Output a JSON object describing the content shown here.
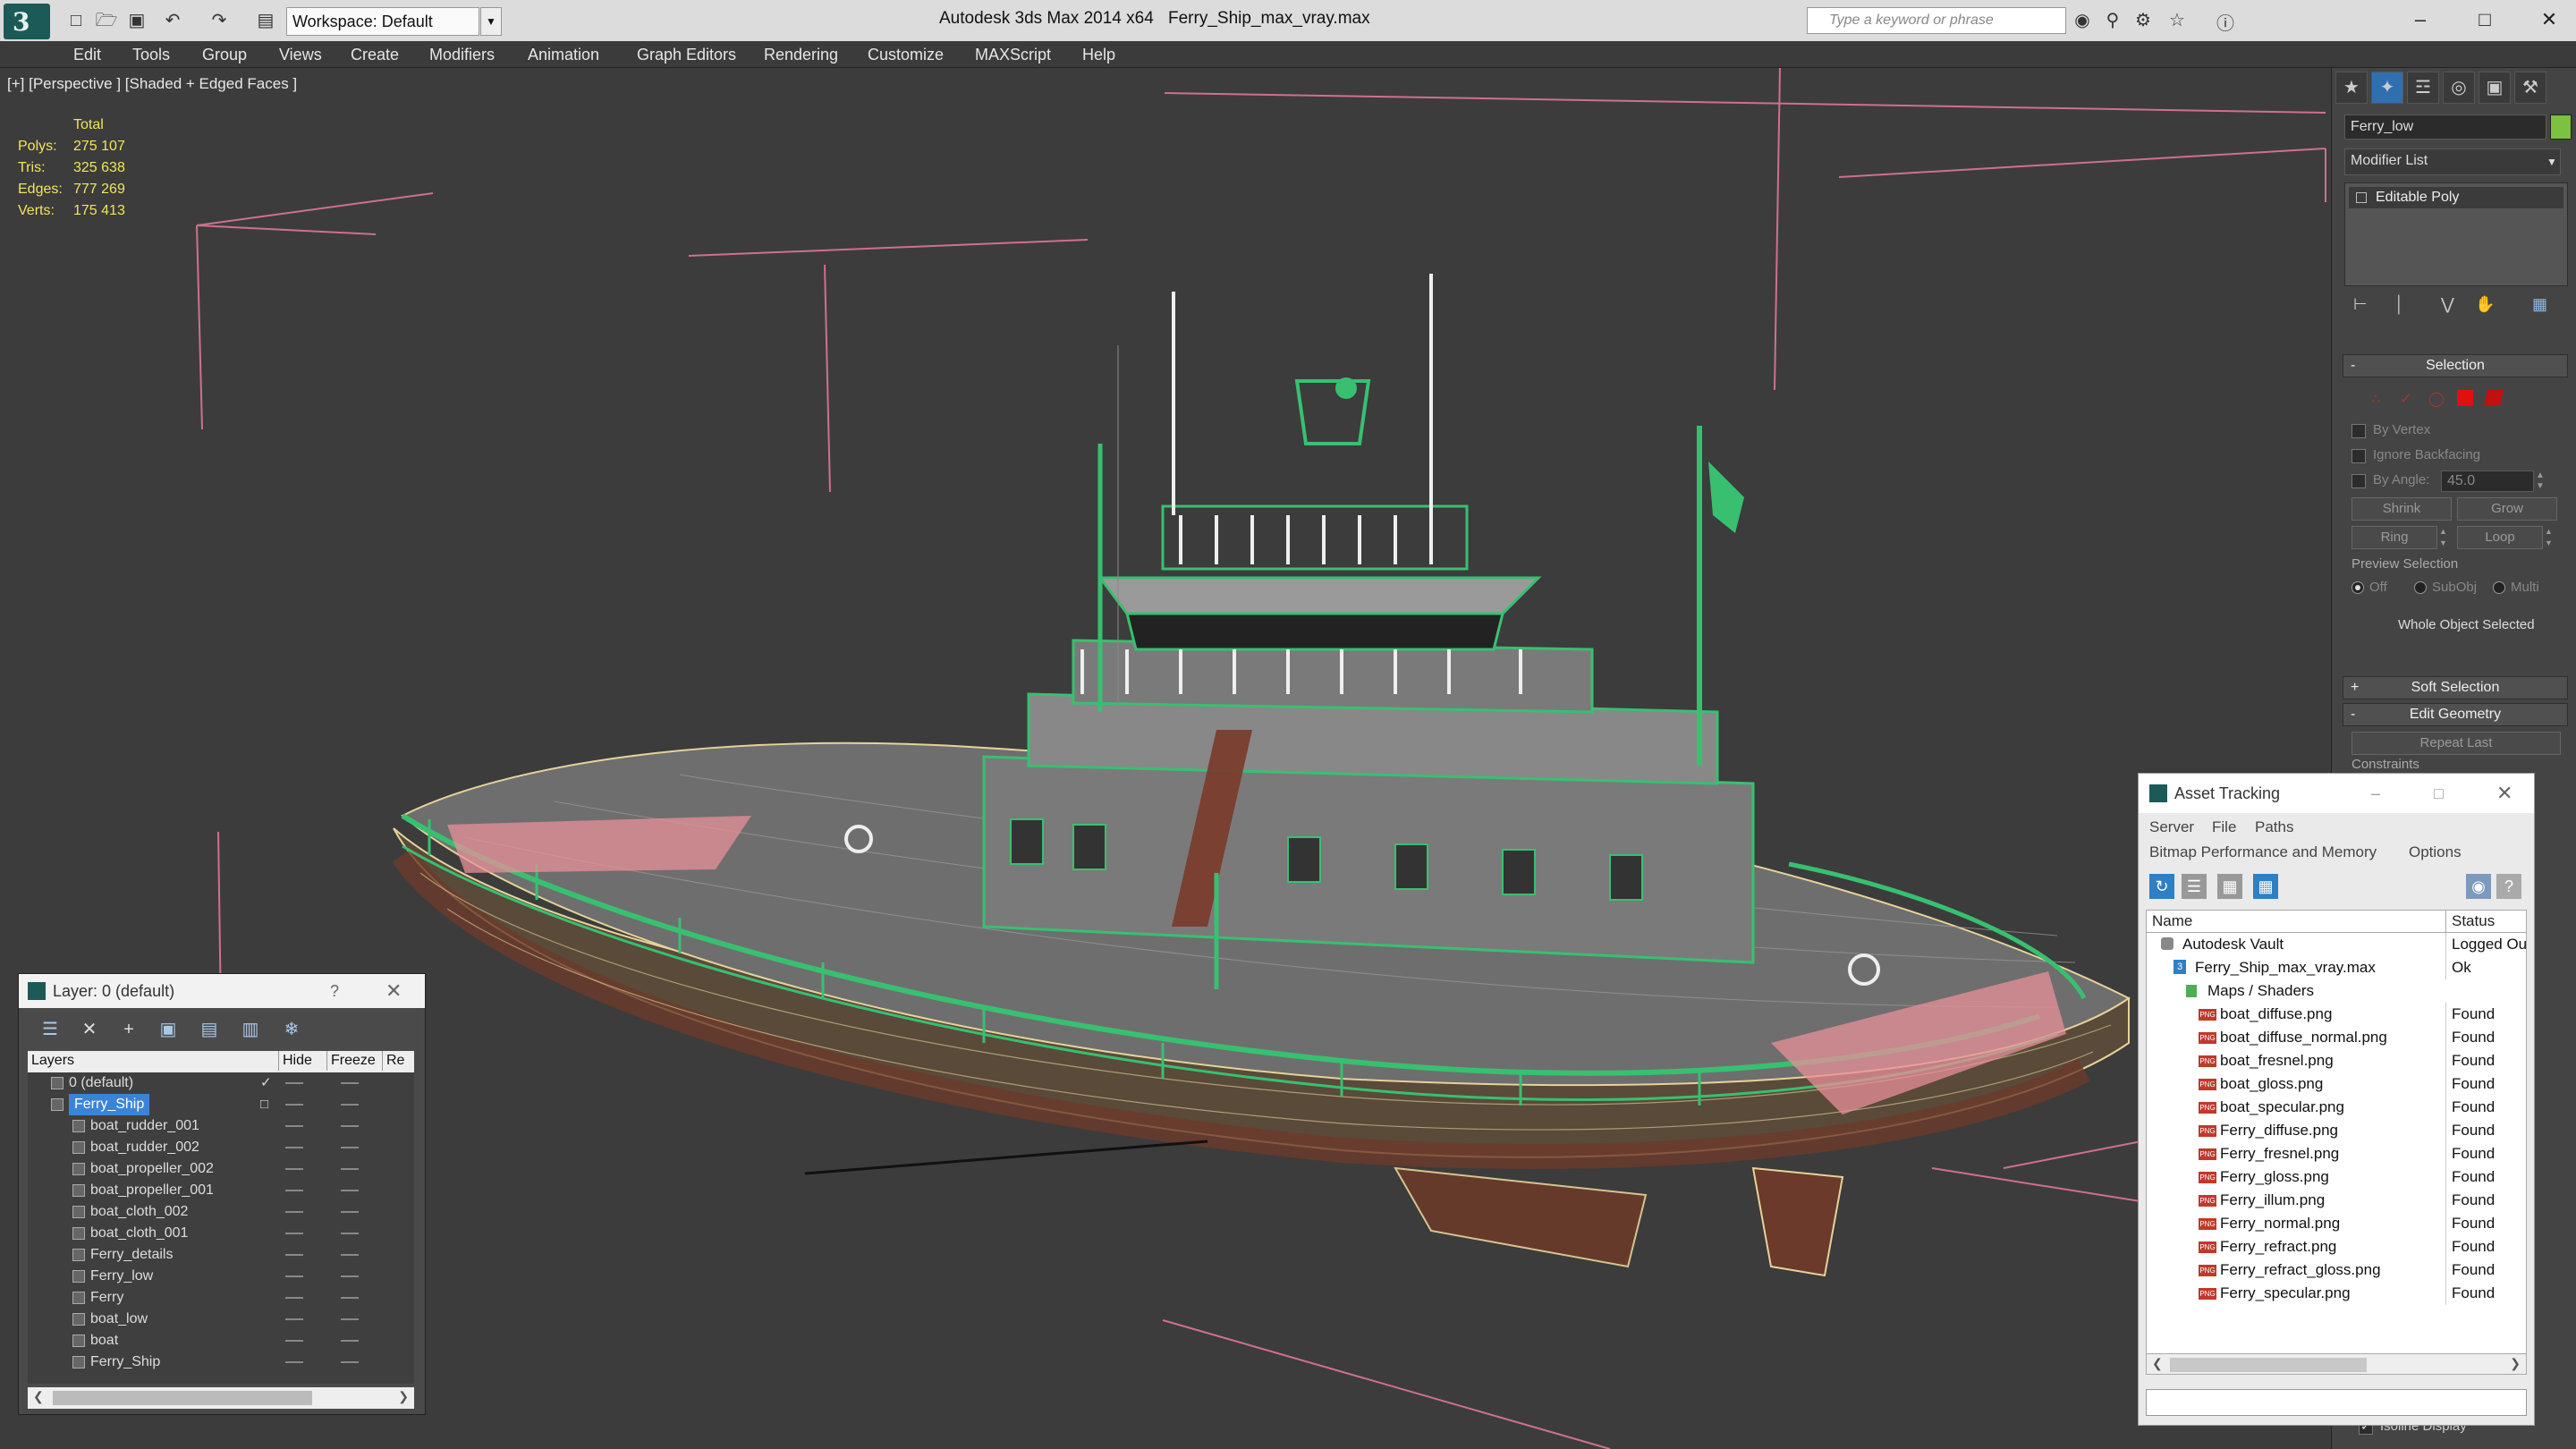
{
  "titlebar": {
    "logo_glyph": "3",
    "workspace": "Workspace: Default",
    "app_title": "Autodesk 3ds Max  2014 x64",
    "file_title": "Ferry_Ship_max_vray.max",
    "search_placeholder": "Type a keyword or phrase"
  },
  "menu": [
    "Edit",
    "Tools",
    "Group",
    "Views",
    "Create",
    "Modifiers",
    "Animation",
    "Graph Editors",
    "Rendering",
    "Customize",
    "MAXScript",
    "Help"
  ],
  "viewport": {
    "label": "[+] [Perspective ] [Shaded + Edged Faces ]",
    "stats_header": "Total",
    "stats": [
      {
        "key": "Polys:",
        "value": "275 107"
      },
      {
        "key": "Tris:",
        "value": "325 638"
      },
      {
        "key": "Edges:",
        "value": "777 269"
      },
      {
        "key": "Verts:",
        "value": "175 413"
      }
    ]
  },
  "command_panel": {
    "object_name": "Ferry_low",
    "object_color": "#7dc142",
    "modifier_list": "Modifier List",
    "stack_item": "Editable Poly",
    "selection_title": "Selection",
    "by_vertex": "By Vertex",
    "ignore_backfacing": "Ignore Backfacing",
    "by_angle": "By Angle:",
    "angle_value": "45.0",
    "shrink": "Shrink",
    "grow": "Grow",
    "ring": "Ring",
    "loop": "Loop",
    "preview_selection": "Preview Selection",
    "off": "Off",
    "subobj": "SubObj",
    "multi": "Multi",
    "whole_object": "Whole Object Selected",
    "soft_selection": "Soft Selection",
    "edit_geometry": "Edit Geometry",
    "repeat_last": "Repeat Last",
    "constraints": "Constraints",
    "isoline": "Isoline Display"
  },
  "layer_dialog": {
    "title": "Layer: 0 (default)",
    "help": "?",
    "col_layers": "Layers",
    "col_hide": "Hide",
    "col_freeze": "Freeze",
    "col_render": "Re",
    "rows": [
      {
        "name": "0 (default)",
        "indent": 0,
        "checked": true
      },
      {
        "name": "Ferry_Ship",
        "indent": 0,
        "selected": true
      },
      {
        "name": "boat_rudder_001",
        "indent": 1
      },
      {
        "name": "boat_rudder_002",
        "indent": 1
      },
      {
        "name": "boat_propeller_002",
        "indent": 1
      },
      {
        "name": "boat_propeller_001",
        "indent": 1
      },
      {
        "name": "boat_cloth_002",
        "indent": 1
      },
      {
        "name": "boat_cloth_001",
        "indent": 1
      },
      {
        "name": "Ferry_details",
        "indent": 1
      },
      {
        "name": "Ferry_low",
        "indent": 1
      },
      {
        "name": "Ferry",
        "indent": 1
      },
      {
        "name": "boat_low",
        "indent": 1
      },
      {
        "name": "boat",
        "indent": 1
      },
      {
        "name": "Ferry_Ship",
        "indent": 1
      }
    ]
  },
  "asset_tracking": {
    "title": "Asset Tracking",
    "menu_server": "Server",
    "menu_file": "File",
    "menu_paths": "Paths",
    "menu_bitmap": "Bitmap Performance and Memory",
    "menu_options": "Options",
    "col_name": "Name",
    "col_status": "Status",
    "rows": [
      {
        "name": "Autodesk Vault",
        "status": "Logged Ou",
        "level": 0
      },
      {
        "name": "Ferry_Ship_max_vray.max",
        "status": "Ok",
        "level": 1
      },
      {
        "name": "Maps / Shaders",
        "status": "",
        "level": 2
      },
      {
        "name": "boat_diffuse.png",
        "status": "Found",
        "level": 3
      },
      {
        "name": "boat_diffuse_normal.png",
        "status": "Found",
        "level": 3
      },
      {
        "name": "boat_fresnel.png",
        "status": "Found",
        "level": 3
      },
      {
        "name": "boat_gloss.png",
        "status": "Found",
        "level": 3
      },
      {
        "name": "boat_specular.png",
        "status": "Found",
        "level": 3
      },
      {
        "name": "Ferry_diffuse.png",
        "status": "Found",
        "level": 3
      },
      {
        "name": "Ferry_fresnel.png",
        "status": "Found",
        "level": 3
      },
      {
        "name": "Ferry_gloss.png",
        "status": "Found",
        "level": 3
      },
      {
        "name": "Ferry_illum.png",
        "status": "Found",
        "level": 3
      },
      {
        "name": "Ferry_normal.png",
        "status": "Found",
        "level": 3
      },
      {
        "name": "Ferry_refract.png",
        "status": "Found",
        "level": 3
      },
      {
        "name": "Ferry_refract_gloss.png",
        "status": "Found",
        "level": 3
      },
      {
        "name": "Ferry_specular.png",
        "status": "Found",
        "level": 3
      }
    ]
  }
}
